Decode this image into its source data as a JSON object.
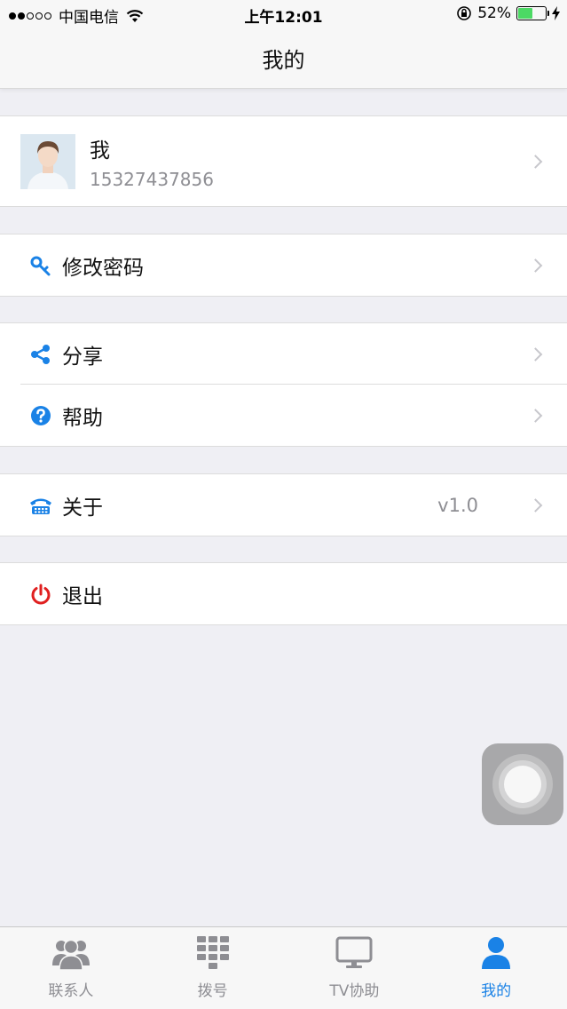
{
  "status_bar": {
    "carrier": "中国电信",
    "time": "上午12:01",
    "battery_percent": "52%",
    "battery_level": 0.52,
    "signal_bars_filled": 2,
    "signal_bars_total": 5
  },
  "nav": {
    "title": "我的"
  },
  "profile": {
    "name": "我",
    "phone": "15327437856"
  },
  "menu": {
    "change_password": {
      "label": "修改密码",
      "icon": "key-icon"
    },
    "share": {
      "label": "分享",
      "icon": "share-icon"
    },
    "help": {
      "label": "帮助",
      "icon": "help-icon"
    },
    "about": {
      "label": "关于",
      "value": "v1.0",
      "icon": "telephone-icon"
    },
    "logout": {
      "label": "退出",
      "icon": "power-icon"
    }
  },
  "tabs": [
    {
      "label": "联系人",
      "icon": "contacts-icon",
      "active": false
    },
    {
      "label": "拨号",
      "icon": "dialpad-icon",
      "active": false
    },
    {
      "label": "TV协助",
      "icon": "tv-icon",
      "active": false
    },
    {
      "label": "我的",
      "icon": "person-icon",
      "active": true
    }
  ],
  "colors": {
    "accent": "#1a82e6",
    "logout_red": "#e02020",
    "tab_inactive": "#8e8e93",
    "background": "#efeff4"
  }
}
